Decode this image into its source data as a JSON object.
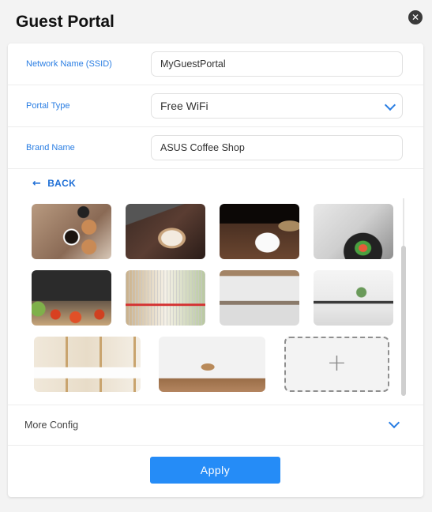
{
  "dialog": {
    "title": "Guest Portal",
    "close_icon": "close-icon"
  },
  "form": {
    "ssid": {
      "label": "Network Name (SSID)",
      "value": "MyGuestPortal"
    },
    "portal_type": {
      "label": "Portal Type",
      "value": "Free WiFi"
    },
    "brand_name": {
      "label": "Brand Name",
      "value": "ASUS Coffee Shop"
    }
  },
  "gallery": {
    "back_label": "BACK",
    "images": [
      {
        "name": "latte-art-cheers",
        "alt": "Coffee cups toast on wooden table"
      },
      {
        "name": "barista-pouring-latte",
        "alt": "Barista pouring latte art"
      },
      {
        "name": "coffee-cup-beans",
        "alt": "Coffee cup with beans on dark wood"
      },
      {
        "name": "chef-plating-dish",
        "alt": "Chef plating a dish"
      },
      {
        "name": "chef-seasoning-vegetables",
        "alt": "Chef seasoning vegetables"
      },
      {
        "name": "supermarket-cart",
        "alt": "Shopping cart in supermarket aisle"
      },
      {
        "name": "open-office",
        "alt": "Open plan office"
      },
      {
        "name": "meeting-room",
        "alt": "Bright meeting room"
      },
      {
        "name": "spa-treatment-room",
        "alt": "Spa treatment room"
      },
      {
        "name": "clinic-office",
        "alt": "Clinic office room"
      }
    ],
    "add_label": "+"
  },
  "more_config": {
    "label": "More Config"
  },
  "actions": {
    "apply_label": "Apply"
  },
  "colors": {
    "accent": "#258cf7",
    "label_blue": "#2a7ee3"
  }
}
